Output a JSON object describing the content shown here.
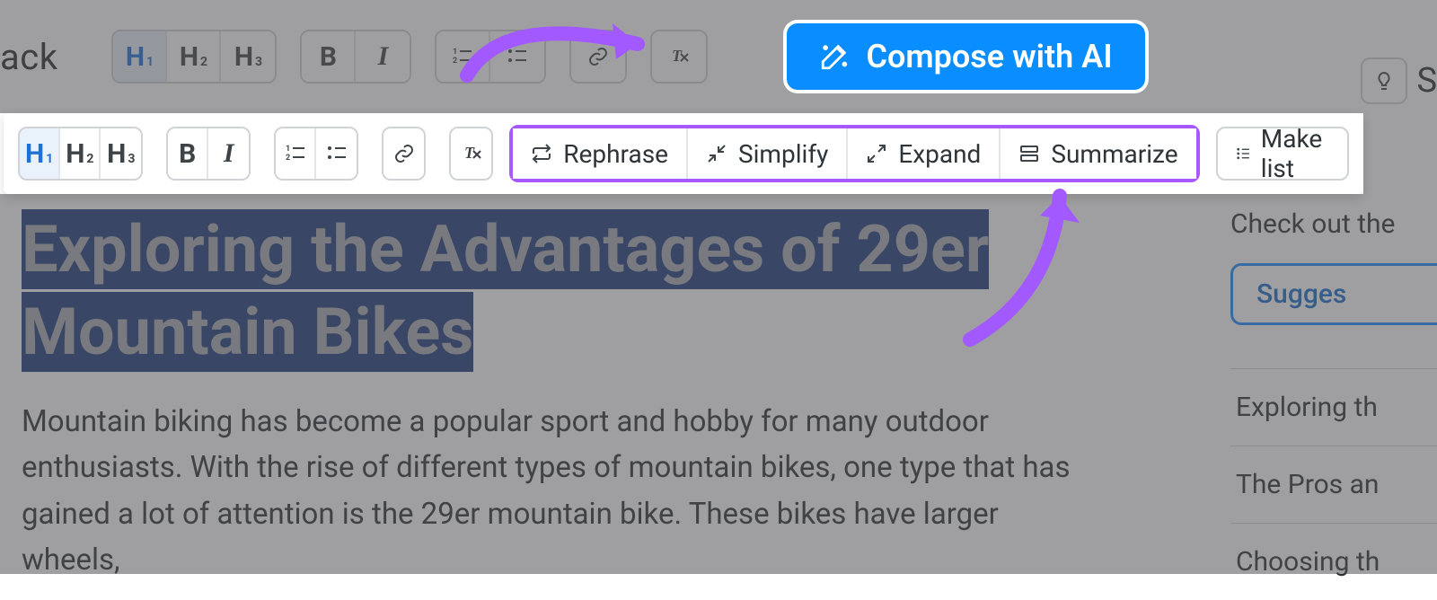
{
  "top_toolbar": {
    "back_label": "ack",
    "h1": "H",
    "h2": "H",
    "h3": "H",
    "bold": "B",
    "italic": "I",
    "compose_label": "Compose with AI",
    "right_s": "S"
  },
  "toolbar2": {
    "h1": "H",
    "h2": "H",
    "h3": "H",
    "bold": "B",
    "italic": "I",
    "rephrase": "Rephrase",
    "simplify": "Simplify",
    "expand": "Expand",
    "summarize": "Summarize",
    "make_list": "Make list"
  },
  "article": {
    "headline": "Exploring the Advantages of 29er Mountain Bikes",
    "body": "Mountain biking has become a popular sport and hobby for many outdoor enthusiasts. With the rise of different types of mountain bikes, one type that has gained a lot of attention is the 29er mountain bike. These bikes have larger wheels,"
  },
  "sidebar": {
    "check_out": "Check out the",
    "suggest": "Sugges",
    "row1": "Exploring th",
    "row2": "The Pros an",
    "row3": "Choosing th"
  }
}
